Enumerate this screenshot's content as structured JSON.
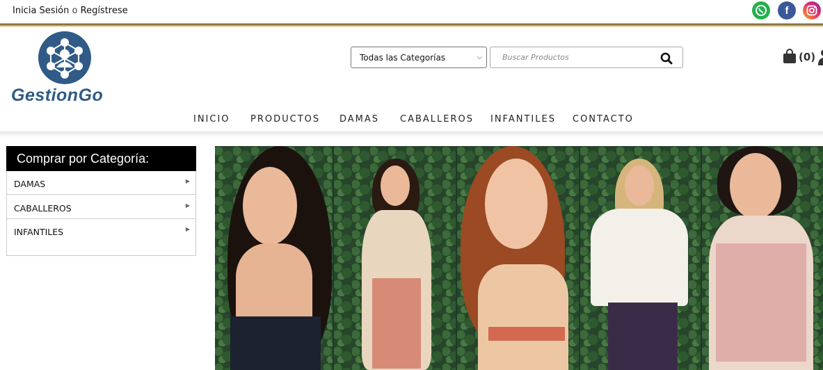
{
  "topbar": {
    "login": "Inicia Sesión",
    "or": "o",
    "register": "Regístrese",
    "social": [
      "whatsapp-icon",
      "facebook-icon",
      "instagram-icon"
    ]
  },
  "brand": {
    "name": "GestionGo",
    "color": "#2f5b86"
  },
  "search": {
    "category_selected": "Todas las Categorías",
    "placeholder": "Buscar Productos"
  },
  "cart": {
    "count": "(0)"
  },
  "nav": [
    "INICIO",
    "PRODUCTOS",
    "DAMAS",
    "CABALLEROS",
    "INFANTILES",
    "CONTACTO"
  ],
  "sidebar": {
    "title": "Comprar por Categoría:",
    "items": [
      "DAMAS",
      "CABALLEROS",
      "INFANTILES"
    ]
  },
  "colors": {
    "accent_line": "#c8a24a",
    "panel_header": "#000000"
  }
}
